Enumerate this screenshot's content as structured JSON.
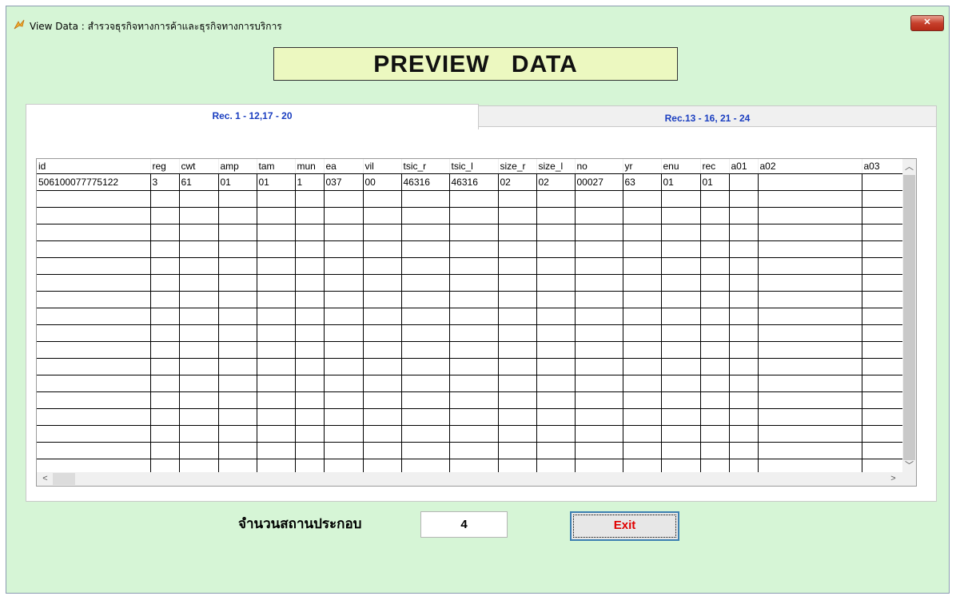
{
  "window": {
    "title": "View Data : สำรวจธุรกิจทางการค้าและธุรกิจทางการบริการ",
    "close_icon": "close-icon",
    "bg_color": "#d6f5d6"
  },
  "header": {
    "title": "PREVIEW DATA"
  },
  "tabs": [
    {
      "label": "Rec. 1 - 12,17 - 20",
      "active": true
    },
    {
      "label": "Rec.13 - 16, 21 - 24",
      "active": false
    }
  ],
  "grid": {
    "columns": [
      "id",
      "reg",
      "cwt",
      "amp",
      "tam",
      "mun",
      "ea",
      "vil",
      "tsic_r",
      "tsic_l",
      "size_r",
      "size_l",
      "no",
      "yr",
      "enu",
      "rec",
      "a01",
      "a02",
      "a03"
    ],
    "rows": [
      [
        "506100077775122",
        "3",
        "61",
        "01",
        "01",
        "1",
        "037",
        "00",
        "46316",
        "46316",
        "02",
        "02",
        "00027",
        "63",
        "01",
        "01",
        "",
        "",
        ""
      ]
    ],
    "empty_rows": 17
  },
  "footer": {
    "count_label": "จำนวนสถานประกอบ",
    "count_value": "4",
    "exit_label": "Exit"
  }
}
